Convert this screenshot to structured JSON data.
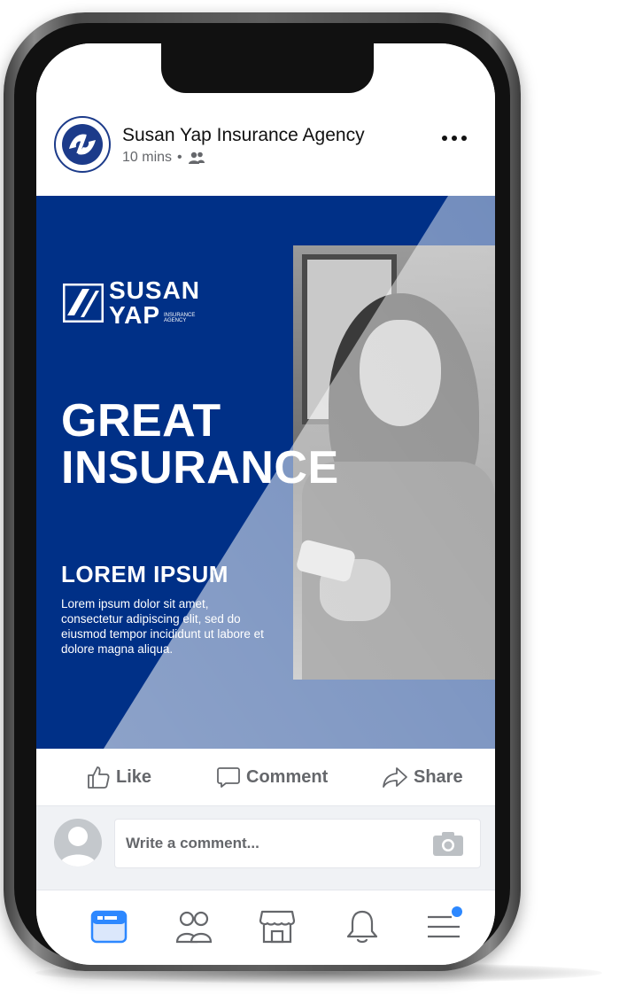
{
  "post": {
    "page_name": "Susan Yap Insurance Agency",
    "time": "10 mins",
    "separator": "•",
    "audience_icon": "friends-icon",
    "more_icon": "more-options-icon"
  },
  "ad": {
    "brand_line1": "SUSAN",
    "brand_line2": "YAP",
    "brand_small_line1": "INSURANCE",
    "brand_small_line2": "AGENCY",
    "headline_line1": "GREAT",
    "headline_line2": "INSURANCE",
    "subheading": "LOREM IPSUM",
    "body": "Lorem ipsum dolor sit amet, consectetur adipiscing elit, sed do eiusmod tempor incididunt ut labore et dolore magna aliqua.",
    "colors": {
      "background": "#003087",
      "text": "#ffffff",
      "overlay": "#ffffff"
    }
  },
  "actions": {
    "like": "Like",
    "comment": "Comment",
    "share": "Share"
  },
  "comment_box": {
    "placeholder": "Write a comment...",
    "camera_icon": "camera-icon"
  },
  "bottom_nav": {
    "items": [
      {
        "icon": "news-feed-icon",
        "active": true
      },
      {
        "icon": "friends-icon",
        "active": false
      },
      {
        "icon": "marketplace-icon",
        "active": false
      },
      {
        "icon": "notifications-bell-icon",
        "active": false
      },
      {
        "icon": "menu-icon",
        "active": false,
        "badge": true
      }
    ],
    "colors": {
      "active": "#2d88ff",
      "inactive": "#65676b"
    }
  }
}
